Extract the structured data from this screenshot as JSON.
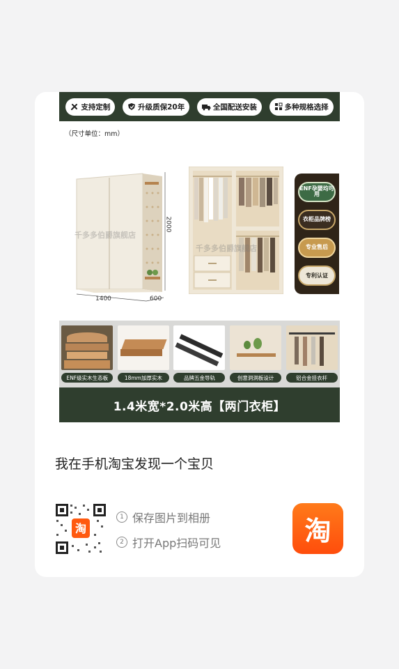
{
  "product_image": {
    "top_tags": [
      {
        "icon": "tools-icon",
        "label": "支持定制"
      },
      {
        "icon": "shield-icon",
        "label": "升级质保20年"
      },
      {
        "icon": "truck-icon",
        "label": "全国配送安装"
      },
      {
        "icon": "grid-icon",
        "label": "多种规格选择"
      }
    ],
    "unit_note": "（尺寸单位：mm）",
    "dimensions": {
      "height": "2000",
      "width": "1400",
      "depth": "600"
    },
    "watermark": "千多多伯爵旗舰店",
    "side_badges": [
      {
        "text": "ENF孕婴均可用",
        "style": "green"
      },
      {
        "text": "衣柜品牌榜",
        "style": "dark"
      },
      {
        "text": "专业售后",
        "style": "gold"
      },
      {
        "text": "专利认证",
        "style": "light"
      }
    ],
    "features": [
      {
        "label": "ENF级实木生态板"
      },
      {
        "label": "18mm加厚实木"
      },
      {
        "label": "品牌五金导轨"
      },
      {
        "label": "创意洞洞板设计"
      },
      {
        "label": "铝合金挂衣杆"
      }
    ],
    "headline": "1.4米宽*2.0米高【两门衣柜】"
  },
  "share": {
    "found_text": "我在手机淘宝发现一个宝贝",
    "steps": [
      {
        "num": "1",
        "text": "保存图片到相册"
      },
      {
        "num": "2",
        "text": "打开App扫码可见"
      }
    ],
    "logo_text": "淘"
  },
  "colors": {
    "brand_green": "#2f3e2e",
    "taobao_orange": "#ff5a10",
    "background": "#f3f3f4"
  }
}
